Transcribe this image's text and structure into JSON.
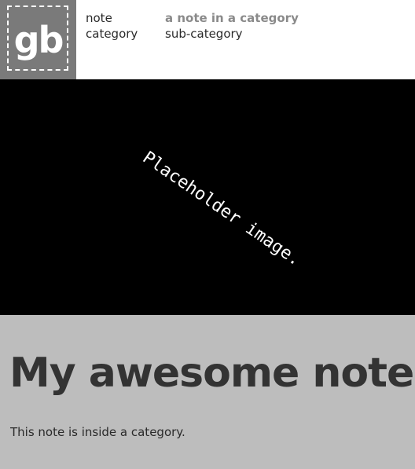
{
  "header": {
    "logo_text": "gb",
    "rows": [
      {
        "label": "note",
        "value": "a note in a category"
      },
      {
        "label": "category",
        "value": "sub-category"
      }
    ]
  },
  "hero": {
    "placeholder_text": "Placeholder image."
  },
  "note": {
    "title": "My awesome note",
    "body": "This note is inside a category."
  },
  "colors": {
    "logo_bg": "#7a7a7a",
    "hero_bg": "#000000",
    "content_bg": "#bdbdbd",
    "text_dark": "#333333",
    "value_gray": "#8a8a8a"
  }
}
